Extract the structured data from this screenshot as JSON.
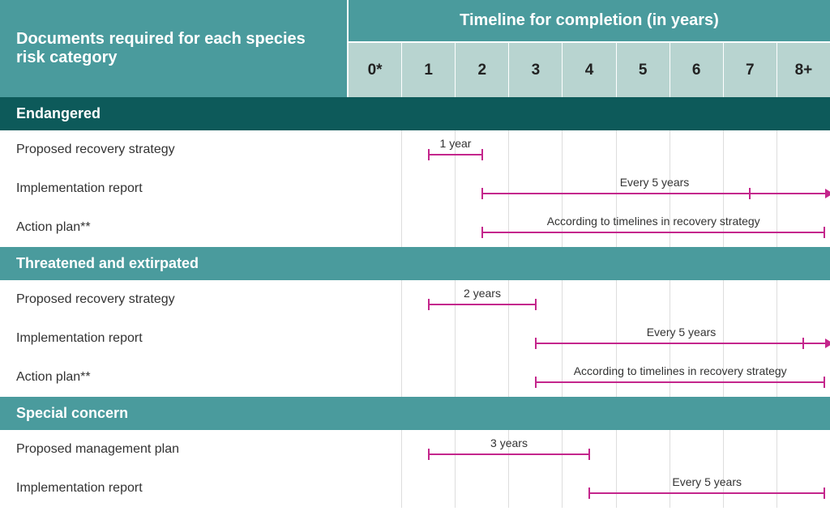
{
  "header": {
    "left": "Documents required for each species risk category",
    "title": "Timeline for completion (in years)",
    "years": [
      "0*",
      "1",
      "2",
      "3",
      "4",
      "5",
      "6",
      "7",
      "8+"
    ]
  },
  "chart_data": {
    "type": "gantt",
    "x_axis": {
      "label": "years",
      "ticks": [
        0,
        1,
        2,
        3,
        4,
        5,
        6,
        7,
        8
      ]
    },
    "sections": [
      {
        "name": "Endangered",
        "header_style": "dark",
        "rows": [
          {
            "label": "Proposed recovery strategy",
            "start": 1,
            "end": 2,
            "text": "1 year",
            "end_type": "cap"
          },
          {
            "label": "Implementation report",
            "start": 2,
            "end": 8.5,
            "text": "Every 5 years",
            "end_type": "arrow",
            "tick_at": 7
          },
          {
            "label": "Action plan**",
            "start": 2,
            "end": 8.4,
            "text": "According to timelines in recovery strategy",
            "end_type": "cap"
          }
        ]
      },
      {
        "name": "Threatened and extirpated",
        "header_style": "light",
        "rows": [
          {
            "label": "Proposed recovery strategy",
            "start": 1,
            "end": 3,
            "text": "2 years",
            "end_type": "cap"
          },
          {
            "label": "Implementation report",
            "start": 3,
            "end": 8.5,
            "text": "Every 5 years",
            "end_type": "arrow",
            "tick_at": 8
          },
          {
            "label": "Action plan**",
            "start": 3,
            "end": 8.4,
            "text": "According to timelines in recovery strategy",
            "end_type": "cap"
          }
        ]
      },
      {
        "name": "Special concern",
        "header_style": "light",
        "rows": [
          {
            "label": "Proposed management plan",
            "start": 1,
            "end": 4,
            "text": "3 years",
            "end_type": "cap"
          },
          {
            "label": "Implementation report",
            "start": 4,
            "end": 8.4,
            "text": "Every 5 years",
            "end_type": "cap"
          }
        ]
      }
    ]
  }
}
